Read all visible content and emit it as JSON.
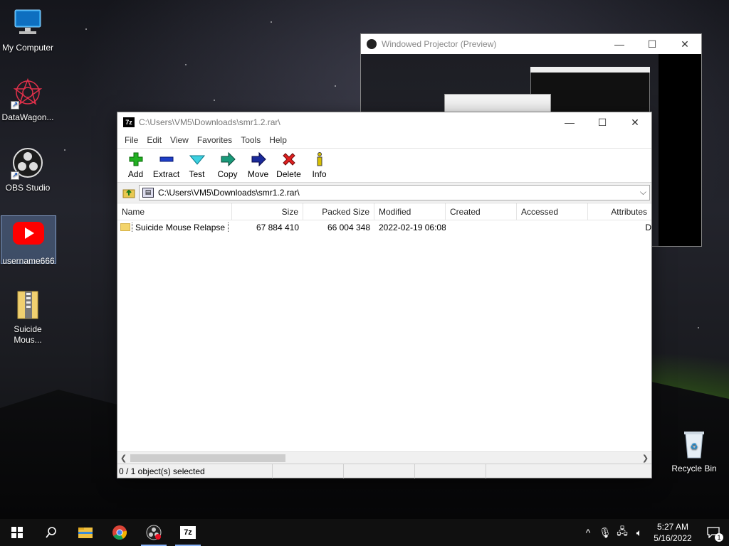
{
  "desktop": {
    "icons": [
      {
        "label": "My Computer"
      },
      {
        "label": "DataWagon..."
      },
      {
        "label": "OBS Studio"
      },
      {
        "label": "username666"
      },
      {
        "label": "Suicide Mous..."
      },
      {
        "label": "Recycle Bin"
      }
    ]
  },
  "projector": {
    "title": "Windowed Projector (Preview)"
  },
  "window": {
    "app_icon": "7z",
    "title": "C:\\Users\\VM5\\Downloads\\smr1.2.rar\\",
    "menu": [
      "File",
      "Edit",
      "View",
      "Favorites",
      "Tools",
      "Help"
    ],
    "toolbar": [
      {
        "label": "Add",
        "icon": "plus-icon",
        "color": "#1aa31a"
      },
      {
        "label": "Extract",
        "icon": "minus-icon",
        "color": "#1f3fc8"
      },
      {
        "label": "Test",
        "icon": "check-icon",
        "color": "#1bb4c8"
      },
      {
        "label": "Copy",
        "icon": "copy-arrow-icon",
        "color": "#1a8a7a"
      },
      {
        "label": "Move",
        "icon": "move-arrow-icon",
        "color": "#1a2a8a"
      },
      {
        "label": "Delete",
        "icon": "x-icon",
        "color": "#d01a1a"
      },
      {
        "label": "Info",
        "icon": "info-icon",
        "color": "#c8b000"
      }
    ],
    "address": "C:\\Users\\VM5\\Downloads\\smr1.2.rar\\",
    "columns": [
      "Name",
      "Size",
      "Packed Size",
      "Modified",
      "Created",
      "Accessed",
      "Attributes"
    ],
    "rows": [
      {
        "name": "Suicide Mouse Relapse",
        "size": "67 884 410",
        "packed": "66 004 348",
        "modified": "2022-02-19 06:08",
        "created": "",
        "accessed": "",
        "attributes": "D"
      }
    ],
    "status": {
      "selection": "0 / 1 object(s) selected",
      "size": "",
      "packed": "",
      "modified": ""
    }
  },
  "taskbar": {
    "clock_time": "5:27 AM",
    "clock_date": "5/16/2022",
    "notification_count": "1"
  }
}
